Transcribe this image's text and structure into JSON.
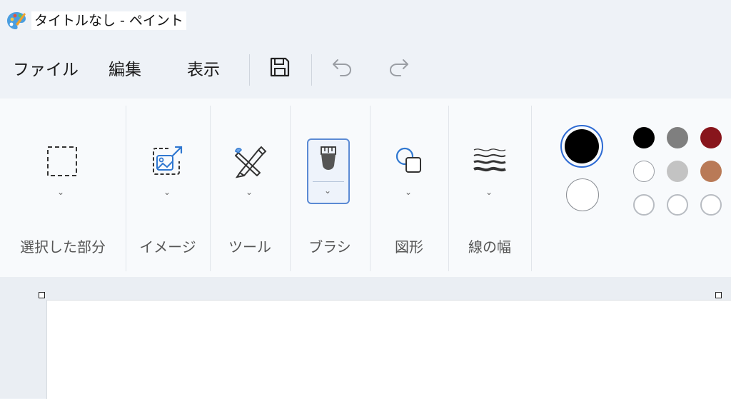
{
  "window": {
    "title": "タイトルなし - ペイント"
  },
  "menu": {
    "file": "ファイル",
    "edit": "編集",
    "view": "表示"
  },
  "toolbar_icons": [
    "save-icon",
    "undo-icon",
    "redo-icon"
  ],
  "ribbon": {
    "groups": [
      {
        "label": "選択した部分",
        "icon": "selection-icon"
      },
      {
        "label": "イメージ",
        "icon": "image-icon"
      },
      {
        "label": "ツール",
        "icon": "tools-icon"
      },
      {
        "label": "ブラシ",
        "icon": "brush-icon"
      },
      {
        "label": "図形",
        "icon": "shapes-icon"
      },
      {
        "label": "線の幅",
        "icon": "line-width-icon"
      }
    ]
  },
  "colors": {
    "primary": "#000000",
    "secondary": "#ffffff",
    "palette": [
      [
        "#000000",
        "#7f7f7f",
        "#88151c"
      ],
      [
        "#ffffff",
        "#c3c3c3",
        "#b97a57"
      ],
      [
        "empty",
        "empty",
        "empty"
      ]
    ]
  }
}
